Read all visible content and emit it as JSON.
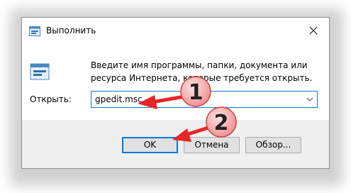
{
  "window": {
    "title": "Выполнить",
    "description": "Введите имя программы, папки, документа или ресурса Интернета, которые требуется открыть.",
    "open_label": "Открыть:",
    "open_value": "gpedit.msc",
    "buttons": {
      "ok": "OK",
      "cancel": "Отмена",
      "browse": "Обзор..."
    }
  },
  "annotations": {
    "step1": "1",
    "step2": "2"
  },
  "colors": {
    "accent": "#0078d7",
    "arrow": "#e8262a",
    "badge": "#f7a8a8"
  },
  "icons": [
    "run-icon",
    "run-large-icon",
    "close-icon",
    "chevron-down-icon"
  ]
}
